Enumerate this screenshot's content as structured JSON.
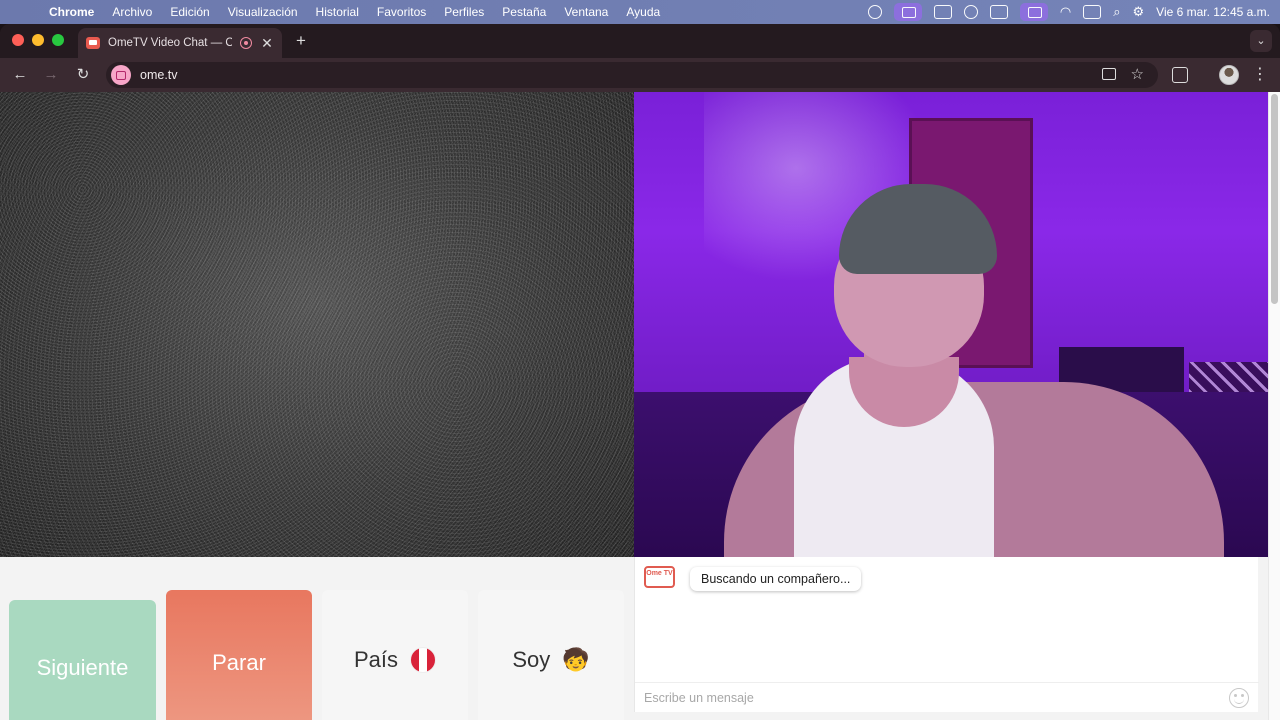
{
  "menubar": {
    "app": "Chrome",
    "items": [
      "Archivo",
      "Edición",
      "Visualización",
      "Historial",
      "Favoritos",
      "Perfiles",
      "Pestaña",
      "Ventana",
      "Ayuda"
    ],
    "clock": "Vie 6 mar.  12:45 a.m."
  },
  "browser": {
    "tab_title": "OmeTV Video Chat — Om",
    "url": "ome.tv"
  },
  "controls": {
    "next_label": "Siguiente",
    "stop_label": "Parar",
    "country_label": "País",
    "soy_label": "Soy",
    "soy_emoji": "🧒"
  },
  "chat": {
    "logo_text": "Ome TV",
    "status_message": "Buscando un compañero...",
    "input_placeholder": "Escribe un mensaje"
  },
  "colors": {
    "next": "#a9d9c0",
    "stop": "#e9826b",
    "menubar": "#7584b8",
    "browser_chrome": "#3a2a31"
  }
}
